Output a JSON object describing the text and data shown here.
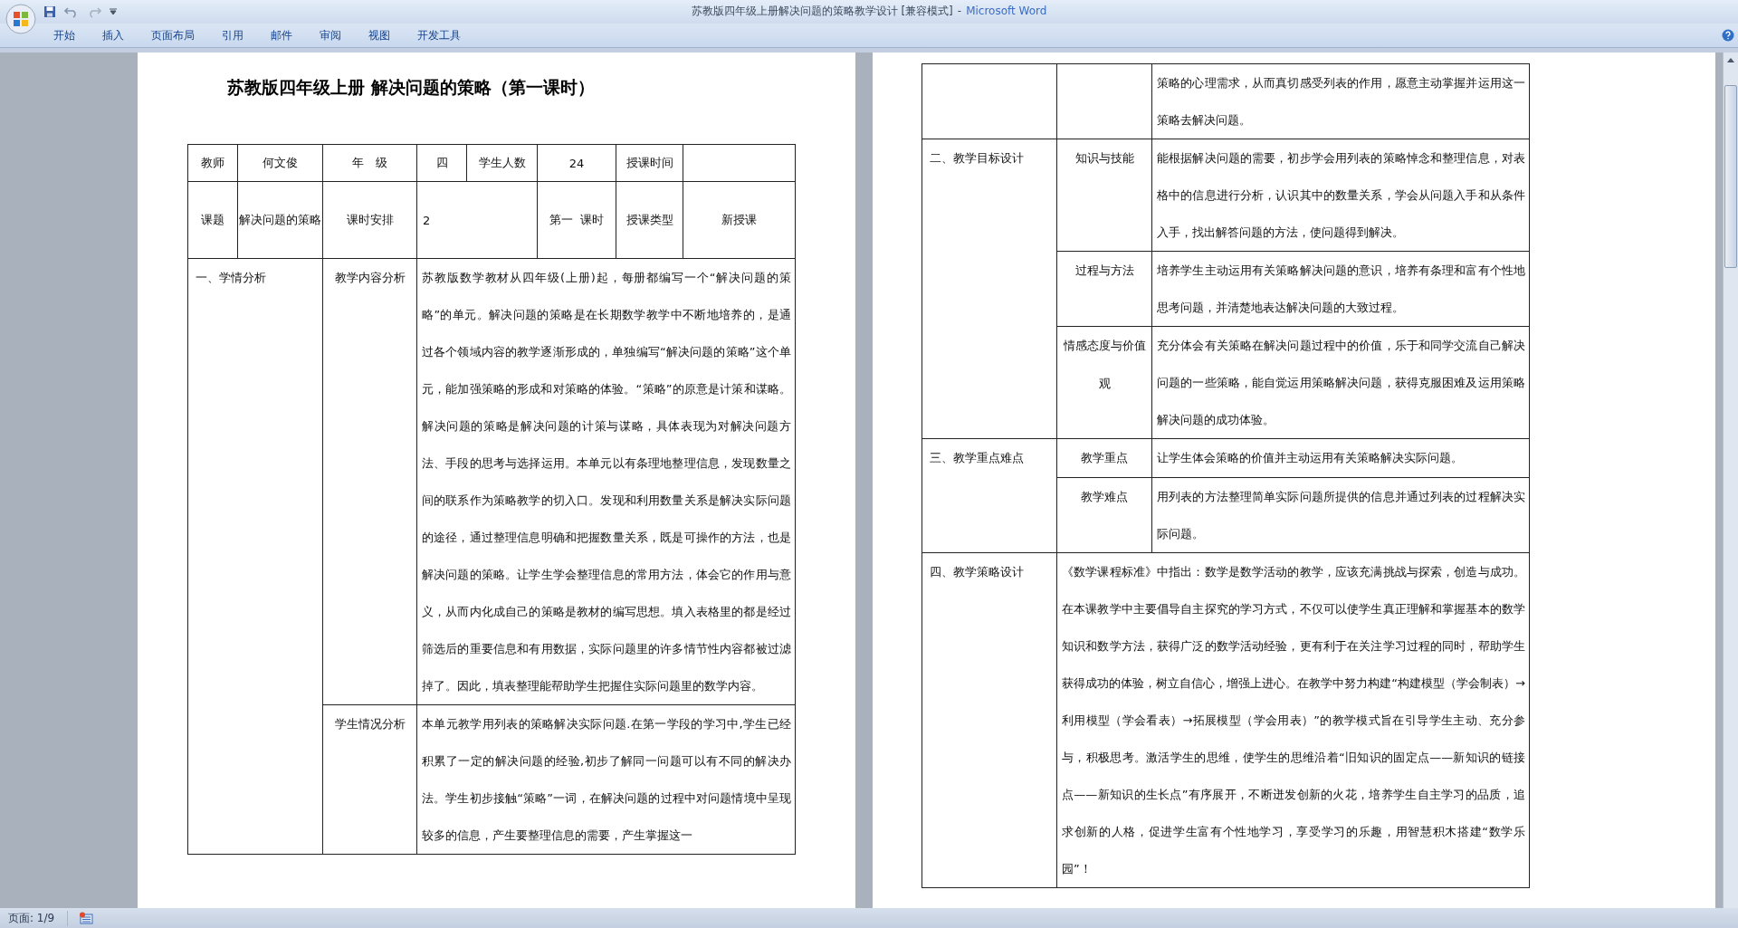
{
  "window": {
    "document": "苏教版四年级上册解决问题的策略教学设计 [兼容模式]",
    "separator": "-",
    "app": "Microsoft Word"
  },
  "ribbon_tabs": [
    "开始",
    "插入",
    "页面布局",
    "引用",
    "邮件",
    "审阅",
    "视图",
    "开发工具"
  ],
  "page_1": {
    "heading": "苏教版四年级上册  解决问题的策略（第一课时）",
    "info": {
      "teacher_label": "教师",
      "teacher": "何文俊",
      "grade_label": "年　级",
      "grade": "四",
      "students_label": "学生人数",
      "students": "24",
      "time_label": "授课时间",
      "topic_label": "课题",
      "topic": "解决问题的策略",
      "schedule_label": "课时安排",
      "schedule": "2",
      "period": "第一  课时",
      "type_label": "授课类型",
      "type": "新授课"
    },
    "sections": [
      {
        "title": "一、学情分析",
        "subs": [
          {
            "label": "教学内容分析",
            "text": "苏教版数学教材从四年级(上册)起，每册都编写一个“解决问题的策略”的单元。解决问题的策略是在长期数学教学中不断地培养的，是通过各个领域内容的教学逐渐形成的，单独编写“解决问题的策略”这个单元，能加强策略的形成和对策略的体验。“策略”的原意是计策和谋略。解决问题的策略是解决问题的计策与谋略，具体表现为对解决问题方法、手段的思考与选择运用。本单元以有条理地整理信息，发现数量之间的联系作为策略教学的切入口。发现和利用数量关系是解决实际问题的途径，通过整理信息明确和把握数量关系，既是可操作的方法，也是解决问题的策略。让学生学会整理信息的常用方法，体会它的作用与意义，从而内化成自己的策略是教材的编写思想。填入表格里的都是经过筛选后的重要信息和有用数据，实际问题里的许多情节性内容都被过滤掉了。因此，填表整理能帮助学生把握住实际问题里的数学内容。"
          },
          {
            "label": "学生情况分析",
            "text": "本单元教学用列表的策略解决实际问题.在第一学段的学习中,学生已经积累了一定的解决问题的经验,初步了解同一问题可以有不同的解决办法。学生初步接触“策略”一词，在解决问题的过程中对问题情境中呈现较多的信息，产生要整理信息的需要，产生掌握这一"
          }
        ]
      }
    ]
  },
  "page_2": {
    "sections": [
      {
        "subs": [
          {
            "text": "策略的心理需求，从而真切感受列表的作用，愿意主动掌握并运用这一策略去解决问题。"
          }
        ]
      },
      {
        "title": "二、教学目标设计",
        "subs": [
          {
            "label": "知识与技能",
            "text": "能根据解决问题的需要，初步学会用列表的策略悼念和整理信息，对表格中的信息进行分析，认识其中的数量关系，学会从问题入手和从条件入手，找出解答问题的方法，使问题得到解决。"
          },
          {
            "label": "过程与方法",
            "text": "培养学生主动运用有关策略解决问题的意识，培养有条理和富有个性地思考问题，并清楚地表达解决问题的大致过程。"
          },
          {
            "label": "情感态度与价值观",
            "text": "充分体会有关策略在解决问题过程中的价值，乐于和同学交流自己解决问题的一些策略，能自觉运用策略解决问题，获得克服困难及运用策略解决问题的成功体验。"
          }
        ]
      },
      {
        "title": "三、教学重点难点",
        "subs": [
          {
            "label": "教学重点",
            "text": "让学生体会策略的价值并主动运用有关策略解决实际问题。"
          },
          {
            "label": "教学难点",
            "text": "用列表的方法整理简单实际问题所提供的信息并通过列表的过程解决实际问题。"
          }
        ]
      },
      {
        "title": "四、教学策略设计",
        "text": "《数学课程标准》中指出：数学是数学活动的教学，应该充满挑战与探索，创造与成功。在本课教学中主要倡导自主探究的学习方式，不仅可以使学生真正理解和掌握基本的数学知识和数学方法，获得广泛的数学活动经验，更有利于在关注学习过程的同时，帮助学生获得成功的体验，树立自信心，增强上进心。在教学中努力构建“构建模型（学会制表）→利用模型（学会看表）→拓展模型（学会用表）”的教学模式旨在引导学生主动、充分参与，积极思考。激活学生的思维，使学生的思维沿着“旧知识的固定点——新知识的链接点——新知识的生长点”有序展开，不断迸发创新的火花，培养学生自主学习的品质，追求创新的人格，促进学生富有个性地学习，享受学习的乐趣，用智慧积木搭建“数学乐园”！"
      }
    ]
  },
  "status_bar": {
    "page": "页面: 1/9"
  }
}
